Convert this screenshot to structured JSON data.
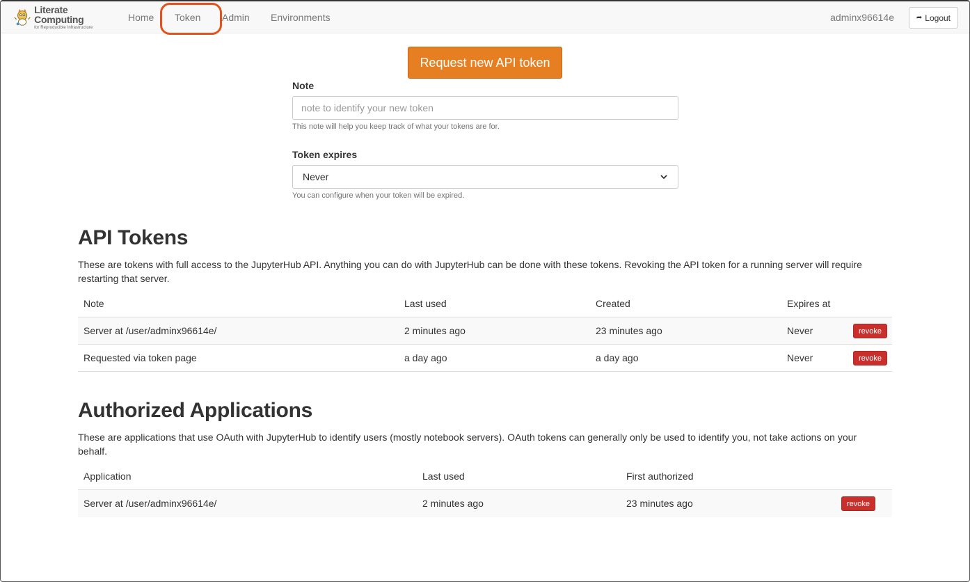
{
  "brand": {
    "title": "Literate Computing",
    "subtitle": "for Reproducible Infrastructure",
    "icon": "mascot-logo-icon"
  },
  "nav": {
    "items": [
      {
        "label": "Home"
      },
      {
        "label": "Token"
      },
      {
        "label": "Admin"
      },
      {
        "label": "Environments"
      }
    ],
    "active": "Token",
    "highlight_color": "#e0531f"
  },
  "user": {
    "name": "adminx96614e",
    "logout_label": "Logout",
    "logout_icon": "sign-out-icon"
  },
  "request_form": {
    "button_label": "Request new API token",
    "button_color": "#e67e22",
    "note_label": "Note",
    "note_placeholder": "note to identify your new token",
    "note_help": "This note will help you keep track of what your tokens are for.",
    "expires_label": "Token expires",
    "expires_value": "Never",
    "expires_help": "You can configure when your token will be expired."
  },
  "api_tokens": {
    "heading": "API Tokens",
    "description": "These are tokens with full access to the JupyterHub API. Anything you can do with JupyterHub can be done with these tokens. Revoking the API token for a running server will require restarting that server.",
    "columns": [
      "Note",
      "Last used",
      "Created",
      "Expires at"
    ],
    "rows": [
      {
        "note": "Server at /user/adminx96614e/",
        "last_used": "2 minutes ago",
        "created": "23 minutes ago",
        "expires_at": "Never",
        "action": "revoke"
      },
      {
        "note": "Requested via token page",
        "last_used": "a day ago",
        "created": "a day ago",
        "expires_at": "Never",
        "action": "revoke"
      }
    ]
  },
  "authorized_apps": {
    "heading": "Authorized Applications",
    "description": "These are applications that use OAuth with JupyterHub to identify users (mostly notebook servers). OAuth tokens can generally only be used to identify you, not take actions on your behalf.",
    "columns": [
      "Application",
      "Last used",
      "First authorized"
    ],
    "rows": [
      {
        "application": "Server at /user/adminx96614e/",
        "last_used": "2 minutes ago",
        "first_authorized": "23 minutes ago",
        "action": "revoke"
      }
    ]
  },
  "colors": {
    "revoke": "#c9302c"
  }
}
